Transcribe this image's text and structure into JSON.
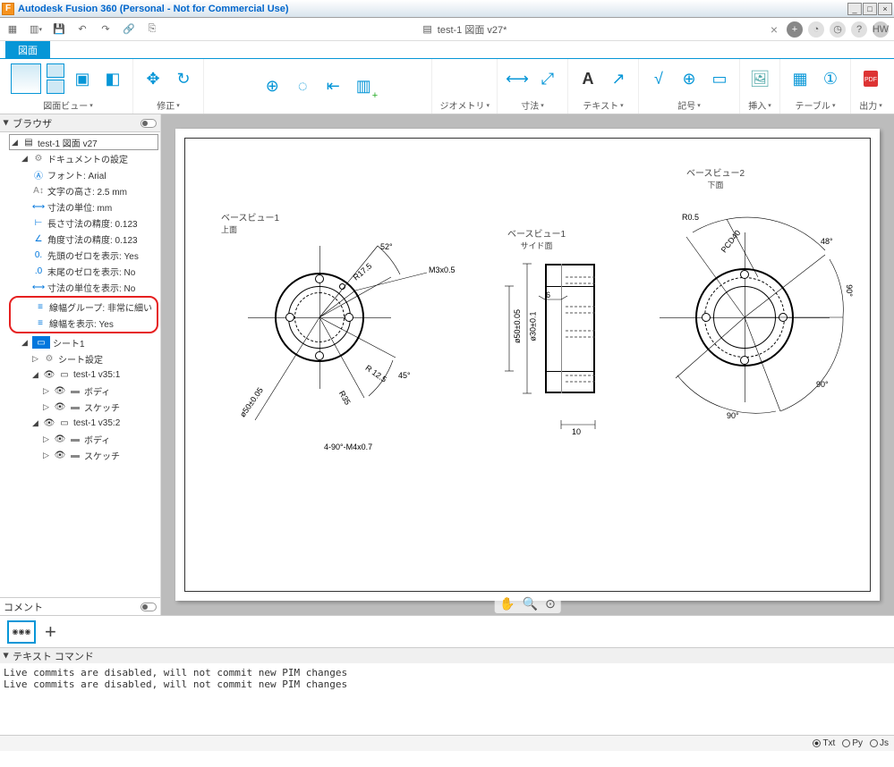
{
  "window": {
    "title": "Autodesk Fusion 360 (Personal - Not for Commercial Use)"
  },
  "doc": {
    "name": "test-1 図面 v27*"
  },
  "ribbon": {
    "active_tab": "図面",
    "groups": {
      "view": "図面ビュー",
      "modify": "修正",
      "geometry": "ジオメトリ",
      "dimensions": "寸法",
      "text": "テキスト",
      "symbols": "記号",
      "insert": "挿入",
      "tables": "テーブル",
      "output": "出力"
    }
  },
  "browser": {
    "title": "ブラウザ",
    "root": "test-1 図面 v27",
    "doc_settings": "ドキュメントの設定",
    "items": [
      {
        "label": "フォント: Arial"
      },
      {
        "label": "文字の高さ: 2.5 mm"
      },
      {
        "label": "寸法の単位: mm"
      },
      {
        "label": "長さ寸法の精度: 0.123"
      },
      {
        "label": "角度寸法の精度: 0.123"
      },
      {
        "label": "先頭のゼロを表示: Yes"
      },
      {
        "label": "末尾のゼロを表示: No"
      },
      {
        "label": "寸法の単位を表示: No"
      },
      {
        "label": "線幅グループ: 非常に細い",
        "hl": true
      },
      {
        "label": "線幅を表示: Yes",
        "hl": true
      }
    ],
    "sheet_label": "シート1",
    "sheet_settings": "シート設定",
    "sheets": [
      {
        "name": "test-1 v35:1",
        "children": [
          "ボディ",
          "スケッチ"
        ]
      },
      {
        "name": "test-1 v35:2",
        "children": [
          "ボディ",
          "スケッチ"
        ]
      }
    ],
    "comment": "コメント"
  },
  "drawing": {
    "view1": {
      "title": "ベースビュー1",
      "sub": "上面"
    },
    "view2": {
      "title": "ベースビュー1",
      "sub": "サイド面"
    },
    "view3": {
      "title": "ベースビュー2",
      "sub": "下面"
    },
    "dims": {
      "ang52": "52°",
      "ang48": "48°",
      "ang45": "45°",
      "ang90a": "90°",
      "ang90b": "90°",
      "ang90c": "90°",
      "r175": "R17.5",
      "r125": "R 12.5",
      "r35": "R35",
      "r05": "R0.5",
      "m3": "M3x0.5",
      "m4": "4-90°-M4x0.7",
      "d50": "ø50±0.05",
      "d30": "ø30±0.1",
      "w6": "6",
      "w10": "10",
      "pcd": "PCD40"
    }
  },
  "textcmd": {
    "title": "テキスト コマンド",
    "lines": "Live commits are disabled, will not commit new PIM changes\nLive commits are disabled, will not commit new PIM changes"
  },
  "radios": {
    "txt": "Txt",
    "py": "Py",
    "js": "Js"
  }
}
